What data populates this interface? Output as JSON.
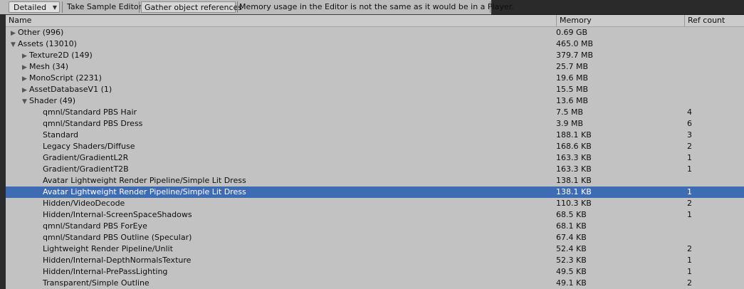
{
  "toolbar": {
    "mode_value": "Detailed",
    "take_sample_label": "Take Sample Editor",
    "gather_label": "Gather object references",
    "note": "Memory usage in the Editor is not the same as it would be in a Player."
  },
  "columns": {
    "name": "Name",
    "memory": "Memory",
    "ref_count": "Ref count"
  },
  "rows": [
    {
      "name": "Other (996)",
      "memory": "0.69 GB",
      "ref": "",
      "level": 0,
      "toggle": "collapsed"
    },
    {
      "name": "Assets (13010)",
      "memory": "465.0 MB",
      "ref": "",
      "level": 0,
      "toggle": "expanded"
    },
    {
      "name": "Texture2D (149)",
      "memory": "379.7 MB",
      "ref": "",
      "level": 1,
      "toggle": "collapsed"
    },
    {
      "name": "Mesh (34)",
      "memory": "25.7 MB",
      "ref": "",
      "level": 1,
      "toggle": "collapsed"
    },
    {
      "name": "MonoScript (2231)",
      "memory": "19.6 MB",
      "ref": "",
      "level": 1,
      "toggle": "collapsed"
    },
    {
      "name": "AssetDatabaseV1 (1)",
      "memory": "15.5 MB",
      "ref": "",
      "level": 1,
      "toggle": "collapsed"
    },
    {
      "name": "Shader (49)",
      "memory": "13.6 MB",
      "ref": "",
      "level": 1,
      "toggle": "expanded"
    },
    {
      "name": "qmnl/Standard PBS Hair",
      "memory": "7.5 MB",
      "ref": "4",
      "level": 2,
      "toggle": "none"
    },
    {
      "name": "qmnl/Standard PBS Dress",
      "memory": "3.9 MB",
      "ref": "6",
      "level": 2,
      "toggle": "none"
    },
    {
      "name": "Standard",
      "memory": "188.1 KB",
      "ref": "3",
      "level": 2,
      "toggle": "none"
    },
    {
      "name": "Legacy Shaders/Diffuse",
      "memory": "168.6 KB",
      "ref": "2",
      "level": 2,
      "toggle": "none"
    },
    {
      "name": "Gradient/GradientL2R",
      "memory": "163.3 KB",
      "ref": "1",
      "level": 2,
      "toggle": "none"
    },
    {
      "name": "Gradient/GradientT2B",
      "memory": "163.3 KB",
      "ref": "1",
      "level": 2,
      "toggle": "none"
    },
    {
      "name": "Avatar Lightweight Render Pipeline/Simple Lit Dress",
      "memory": "138.1 KB",
      "ref": "",
      "level": 2,
      "toggle": "none"
    },
    {
      "name": "Avatar Lightweight Render Pipeline/Simple Lit Dress",
      "memory": "138.1 KB",
      "ref": "1",
      "level": 2,
      "toggle": "none",
      "selected": true
    },
    {
      "name": "Hidden/VideoDecode",
      "memory": "110.3 KB",
      "ref": "2",
      "level": 2,
      "toggle": "none"
    },
    {
      "name": "Hidden/Internal-ScreenSpaceShadows",
      "memory": "68.5 KB",
      "ref": "1",
      "level": 2,
      "toggle": "none"
    },
    {
      "name": "qmnl/Standard PBS ForEye",
      "memory": "68.1 KB",
      "ref": "",
      "level": 2,
      "toggle": "none"
    },
    {
      "name": "qmnl/Standard PBS Outline (Specular)",
      "memory": "67.4 KB",
      "ref": "",
      "level": 2,
      "toggle": "none"
    },
    {
      "name": "Lightweight Render Pipeline/Unlit",
      "memory": "52.4 KB",
      "ref": "2",
      "level": 2,
      "toggle": "none"
    },
    {
      "name": "Hidden/Internal-DepthNormalsTexture",
      "memory": "52.3 KB",
      "ref": "1",
      "level": 2,
      "toggle": "none"
    },
    {
      "name": "Hidden/Internal-PrePassLighting",
      "memory": "49.5 KB",
      "ref": "1",
      "level": 2,
      "toggle": "none"
    },
    {
      "name": "Transparent/Simple Outline",
      "memory": "49.1 KB",
      "ref": "2",
      "level": 2,
      "toggle": "none"
    }
  ]
}
